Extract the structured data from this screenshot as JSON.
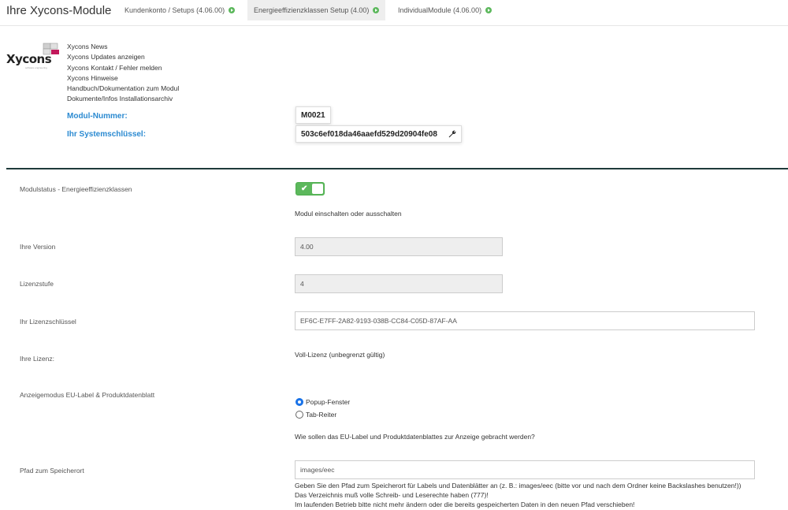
{
  "header": {
    "title": "Ihre Xycons-Module",
    "tabs": [
      {
        "label": "Kundenkonto / Setups (4.06.00)"
      },
      {
        "label": "Energieeffizienzklassen Setup (4.00)"
      },
      {
        "label": "IndividualModule (4.06.00)"
      }
    ]
  },
  "logo": {
    "text": "Xycons",
    "sub": "software engineering"
  },
  "links": [
    "Xycons News",
    "Xycons Updates anzeigen",
    "Xycons Kontakt / Fehler melden",
    "Xycons Hinweise",
    "Handbuch/Dokumentation zum Modul",
    "Dokumente/Infos Installationsarchiv"
  ],
  "module": {
    "number_label": "Modul-Nummer:",
    "number_value": "M0021",
    "key_label": "Ihr Systemschlüssel:",
    "key_value": "503c6ef018da46aaefd529d20904fe08"
  },
  "settings": {
    "status_label": "Modulstatus - Energieeffizienzklassen",
    "status_on": true,
    "status_help": "Modul einschalten oder ausschalten",
    "version_label": "Ihre Version",
    "version_value": "4.00",
    "level_label": "Lizenzstufe",
    "level_value": "4",
    "licensekey_label": "Ihr Lizenzschlüssel",
    "licensekey_value": "EF6C-E7FF-2A82-9193-038B-CC84-C05D-87AF-AA",
    "license_label": "Ihre Lizenz:",
    "license_value": "Voll-Lizenz (unbegrenzt gültig)",
    "display_label": "Anzeigemodus EU-Label & Produktdatenblatt",
    "display_options": [
      "Popup-Fenster",
      "Tab-Reiter"
    ],
    "display_selected": "Popup-Fenster",
    "display_help": "Wie sollen das EU-Label und Produktdatenblattes zur Anzeige gebracht werden?",
    "path_label": "Pfad zum Speicherort",
    "path_value": "images/eec",
    "path_help": [
      "Geben Sie den Pfad zum Speicherort für Labels und Datenblätter an (z. B.: images/eec (bitte vor und nach dem Ordner keine Backslashes benutzen!))",
      "Das Verzeichnis muß volle Schreib- und Leserechte haben (777)!",
      "Im laufenden Betrieb bitte nicht mehr ändern oder die bereits gespeicherten Daten in den neuen Pfad verschieben!"
    ]
  },
  "colors": {
    "accent": "#2b8ad1",
    "toggle_on": "#5cb85c",
    "divider": "#1e3a3a"
  },
  "icons": {
    "tab_status": "play-circle-icon",
    "key_action": "wrench-icon"
  }
}
